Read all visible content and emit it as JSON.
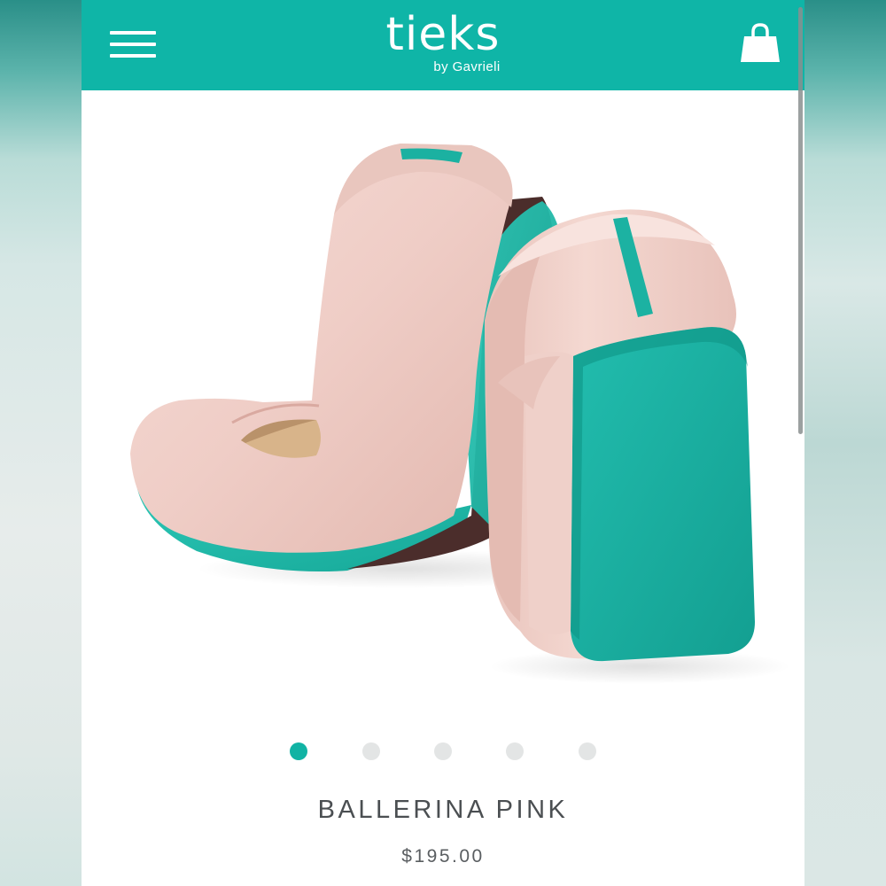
{
  "header": {
    "brand": "tieks",
    "brand_sub": "by Gavrieli",
    "menu_icon": "hamburger-menu-icon",
    "cart_icon": "shopping-bag-icon",
    "color": "#0fb5a7"
  },
  "carousel": {
    "image_alt": "Ballerina Pink ballet flats with turquoise soles",
    "slide_count": 5,
    "active_slide": 1,
    "active_color": "#11b3a4",
    "inactive_color": "#e3e5e5"
  },
  "product": {
    "name": "BALLERINA PINK",
    "price": "$195.00"
  }
}
